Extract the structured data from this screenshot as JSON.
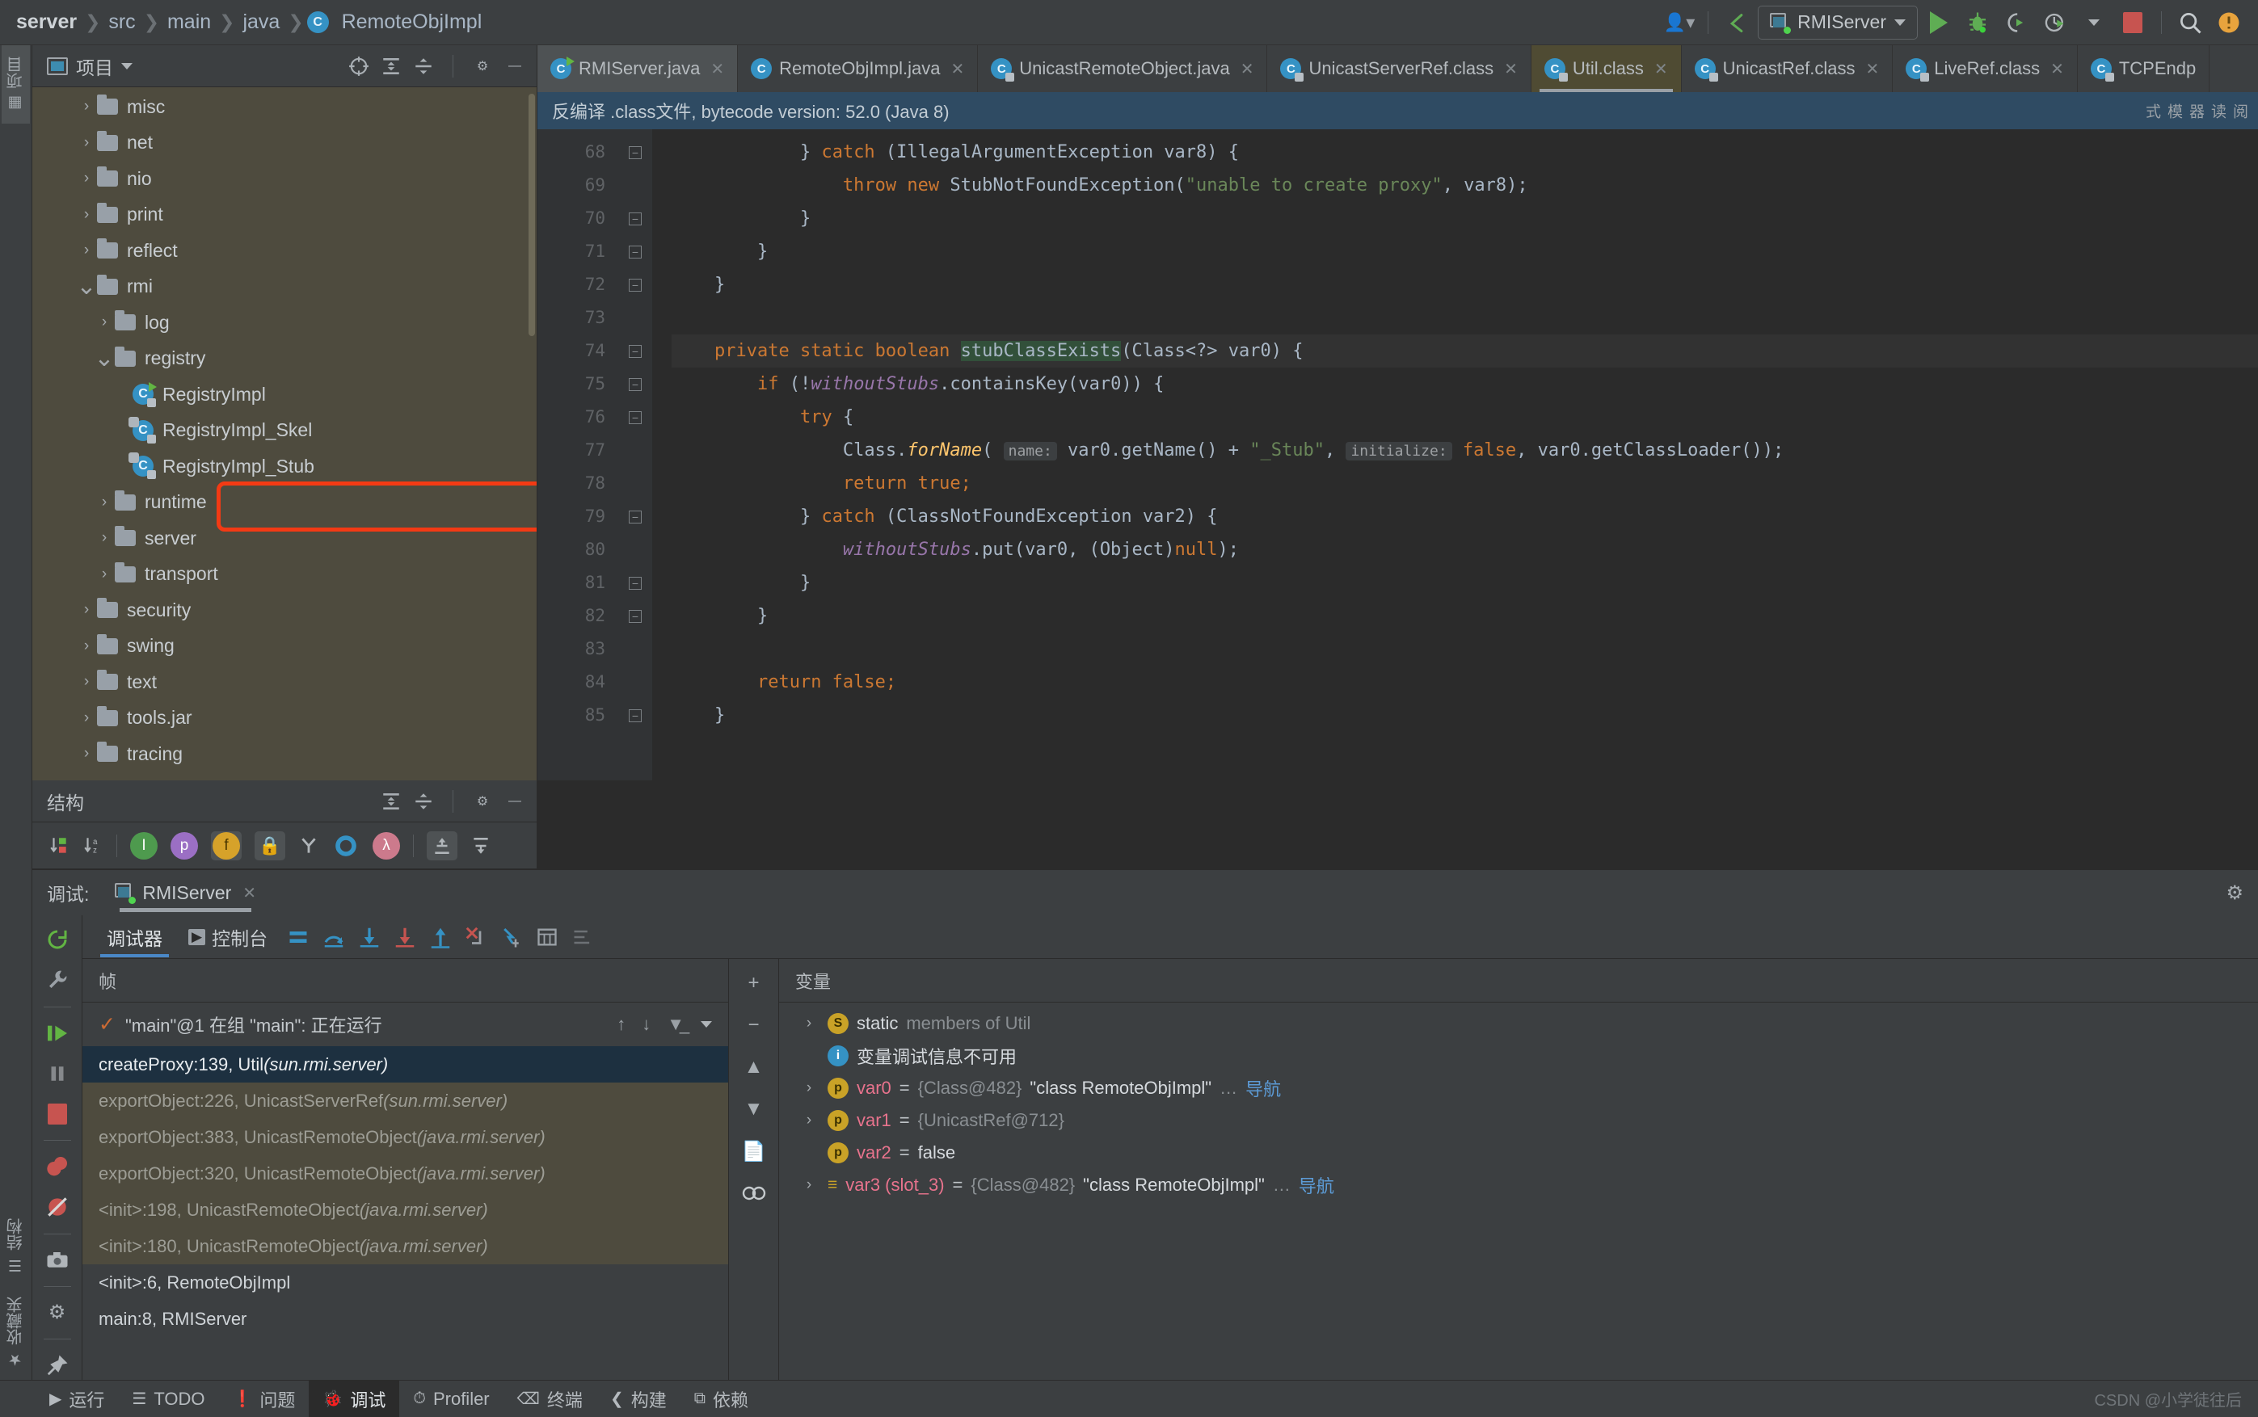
{
  "window": {
    "breadcrumb": [
      "server",
      "src",
      "main",
      "java",
      "RemoteObjImpl"
    ],
    "breadcrumb_class_letter": "C"
  },
  "toolbar": {
    "profile_icon": "user-profile-icon",
    "update_icon": "update-project-icon",
    "run_config_name": "RMIServer",
    "run_label": "run-icon",
    "debug_label": "debug-icon",
    "run_coverage_label": "run-with-coverage-icon",
    "profiler_label": "profiler-icon",
    "stop_label": "stop-icon",
    "search_label": "search-icon"
  },
  "left_strip": {
    "project_tab": "项目",
    "structure_tab": "结构",
    "favorites_tab": "收藏夹"
  },
  "project_panel": {
    "title": "项目",
    "tree": [
      {
        "label": "misc",
        "type": "folder",
        "depth": 2,
        "arrow": "collapsed"
      },
      {
        "label": "net",
        "type": "folder",
        "depth": 2,
        "arrow": "collapsed"
      },
      {
        "label": "nio",
        "type": "folder",
        "depth": 2,
        "arrow": "collapsed"
      },
      {
        "label": "print",
        "type": "folder",
        "depth": 2,
        "arrow": "collapsed"
      },
      {
        "label": "reflect",
        "type": "folder",
        "depth": 2,
        "arrow": "collapsed"
      },
      {
        "label": "rmi",
        "type": "folder",
        "depth": 2,
        "arrow": "expanded"
      },
      {
        "label": "log",
        "type": "folder",
        "depth": 3,
        "arrow": "collapsed"
      },
      {
        "label": "registry",
        "type": "folder",
        "depth": 3,
        "arrow": "expanded"
      },
      {
        "label": "RegistryImpl",
        "type": "class-run",
        "depth": 4,
        "arrow": "none"
      },
      {
        "label": "RegistryImpl_Skel",
        "type": "class-lib",
        "depth": 4,
        "arrow": "none"
      },
      {
        "label": "RegistryImpl_Stub",
        "type": "class-lib",
        "depth": 4,
        "arrow": "none"
      },
      {
        "label": "runtime",
        "type": "folder",
        "depth": 3,
        "arrow": "collapsed"
      },
      {
        "label": "server",
        "type": "folder",
        "depth": 3,
        "arrow": "collapsed"
      },
      {
        "label": "transport",
        "type": "folder",
        "depth": 3,
        "arrow": "collapsed"
      },
      {
        "label": "security",
        "type": "folder",
        "depth": 2,
        "arrow": "collapsed"
      },
      {
        "label": "swing",
        "type": "folder",
        "depth": 2,
        "arrow": "collapsed"
      },
      {
        "label": "text",
        "type": "folder",
        "depth": 2,
        "arrow": "collapsed"
      },
      {
        "label": "tools.jar",
        "type": "folder",
        "depth": 2,
        "arrow": "collapsed"
      },
      {
        "label": "tracing",
        "type": "folder",
        "depth": 2,
        "arrow": "collapsed"
      }
    ],
    "annotation": {
      "color": "#f33a14",
      "highlights": "RegistryImpl_Stub"
    }
  },
  "structure_panel": {
    "title": "结构",
    "toolbar_icons": [
      "sort-by-visibility-icon",
      "sort-alphabetically-icon",
      "show-inherited-icon",
      "show-properties-icon",
      "show-fields-icon",
      "show-non-public-icon",
      "group-by-type-icon",
      "show-anonymous-icon",
      "show-lambdas-icon",
      "expand-all-icon",
      "collapse-all-icon"
    ]
  },
  "editor": {
    "tabs": [
      {
        "label": "RMIServer.java",
        "icon": "java-class-run-icon",
        "state": "inactive"
      },
      {
        "label": "RemoteObjImpl.java",
        "icon": "java-class-icon",
        "state": "inactive"
      },
      {
        "label": "UnicastRemoteObject.java",
        "icon": "java-class-lib-icon",
        "state": "inactive"
      },
      {
        "label": "UnicastServerRef.class",
        "icon": "java-class-lib-icon",
        "state": "inactive"
      },
      {
        "label": "Util.class",
        "icon": "java-class-lib-icon",
        "state": "active"
      },
      {
        "label": "UnicastRef.class",
        "icon": "java-class-lib-icon",
        "state": "inactive"
      },
      {
        "label": "LiveRef.class",
        "icon": "java-class-lib-icon",
        "state": "inactive"
      },
      {
        "label": "TCPEndp",
        "icon": "java-class-lib-icon",
        "state": "inactive"
      }
    ],
    "notice": "反编译 .class文件, bytecode version: 52.0 (Java 8)",
    "reader_mode": "阅读器模式",
    "first_line_number": 68,
    "lines": [
      {
        "n": 68,
        "fold": "end",
        "indent": 3,
        "tokens": [
          {
            "t": "} ",
            "c": "plain"
          },
          {
            "t": "catch",
            "c": "kw"
          },
          {
            "t": " (IllegalArgumentException var8) {",
            "c": "plain"
          }
        ]
      },
      {
        "n": 69,
        "fold": "none",
        "indent": 4,
        "tokens": [
          {
            "t": "throw",
            "c": "kw"
          },
          {
            "t": " ",
            "c": "plain"
          },
          {
            "t": "new",
            "c": "kw"
          },
          {
            "t": " StubNotFoundException(",
            "c": "plain"
          },
          {
            "t": "\"unable to create proxy\"",
            "c": "str"
          },
          {
            "t": ", var8);",
            "c": "plain"
          }
        ]
      },
      {
        "n": 70,
        "fold": "end",
        "indent": 3,
        "tokens": [
          {
            "t": "}",
            "c": "plain"
          }
        ]
      },
      {
        "n": 71,
        "fold": "end",
        "indent": 2,
        "tokens": [
          {
            "t": "}",
            "c": "plain"
          }
        ]
      },
      {
        "n": 72,
        "fold": "end",
        "indent": 1,
        "tokens": [
          {
            "t": "}",
            "c": "plain"
          }
        ]
      },
      {
        "n": 73,
        "fold": "none",
        "indent": 0,
        "tokens": []
      },
      {
        "n": 74,
        "fold": "start",
        "indent": 1,
        "highlight": true,
        "tokens": [
          {
            "t": "private static boolean ",
            "c": "kw"
          },
          {
            "t": "stubClassExists",
            "c": "methhl"
          },
          {
            "t": "(Class<?> var0) {",
            "c": "plain"
          }
        ]
      },
      {
        "n": 75,
        "fold": "start",
        "indent": 2,
        "tokens": [
          {
            "t": "if",
            "c": "kw"
          },
          {
            "t": " (!",
            "c": "plain"
          },
          {
            "t": "withoutStubs",
            "c": "fld"
          },
          {
            "t": ".containsKey(var0)) {",
            "c": "plain"
          }
        ]
      },
      {
        "n": 76,
        "fold": "start",
        "indent": 3,
        "tokens": [
          {
            "t": "try",
            "c": "kw"
          },
          {
            "t": " {",
            "c": "plain"
          }
        ]
      },
      {
        "n": 77,
        "fold": "none",
        "indent": 4,
        "tokens": [
          {
            "t": "Class.",
            "c": "plain"
          },
          {
            "t": "forName",
            "c": "mth"
          },
          {
            "t": "( ",
            "c": "plain"
          },
          {
            "t": "name:",
            "c": "hint"
          },
          {
            "t": " var0.getName() + ",
            "c": "plain"
          },
          {
            "t": "\"_Stub\"",
            "c": "str"
          },
          {
            "t": ", ",
            "c": "plain"
          },
          {
            "t": "initialize:",
            "c": "hint"
          },
          {
            "t": " ",
            "c": "plain"
          },
          {
            "t": "false",
            "c": "kw"
          },
          {
            "t": ", var0.getClassLoader());",
            "c": "plain"
          }
        ]
      },
      {
        "n": 78,
        "fold": "none",
        "indent": 4,
        "tokens": [
          {
            "t": "return true;",
            "c": "kw"
          }
        ]
      },
      {
        "n": 79,
        "fold": "end",
        "indent": 3,
        "tokens": [
          {
            "t": "} ",
            "c": "plain"
          },
          {
            "t": "catch",
            "c": "kw"
          },
          {
            "t": " (ClassNotFoundException var2) {",
            "c": "plain"
          }
        ]
      },
      {
        "n": 80,
        "fold": "none",
        "indent": 4,
        "tokens": [
          {
            "t": "withoutStubs",
            "c": "fld"
          },
          {
            "t": ".put(var0, (Object)",
            "c": "plain"
          },
          {
            "t": "null",
            "c": "kw"
          },
          {
            "t": ");",
            "c": "plain"
          }
        ]
      },
      {
        "n": 81,
        "fold": "end",
        "indent": 3,
        "tokens": [
          {
            "t": "}",
            "c": "plain"
          }
        ]
      },
      {
        "n": 82,
        "fold": "end",
        "indent": 2,
        "tokens": [
          {
            "t": "}",
            "c": "plain"
          }
        ]
      },
      {
        "n": 83,
        "fold": "none",
        "indent": 0,
        "tokens": []
      },
      {
        "n": 84,
        "fold": "none",
        "indent": 2,
        "tokens": [
          {
            "t": "return false;",
            "c": "kw"
          }
        ]
      },
      {
        "n": 85,
        "fold": "end",
        "indent": 1,
        "tokens": [
          {
            "t": "}",
            "c": "plain"
          }
        ]
      }
    ]
  },
  "debug": {
    "label": "调试:",
    "session_tab": "RMIServer",
    "toolbar_tabs": [
      {
        "label": "调试器",
        "active": true
      },
      {
        "label": "控制台",
        "active": false
      }
    ],
    "left_rail_icons": [
      "rerun-icon",
      "wrench-icon",
      "resume-program-icon",
      "pause-program-icon",
      "stop-icon",
      "view-breakpoints-icon",
      "mute-breakpoints-icon",
      "screenshot-icon",
      "settings-icon",
      "pin-tab-icon"
    ],
    "step_icons": [
      "show-execution-point-icon",
      "step-over-icon",
      "step-into-icon",
      "force-step-into-icon",
      "step-out-icon",
      "drop-frame-icon",
      "run-to-cursor-icon",
      "evaluate-expression-icon",
      "settings-icon"
    ],
    "frames": {
      "header": "帧",
      "thread": "\"main\"@1 在组 \"main\": 正在运行",
      "actions": [
        "up-icon",
        "down-icon",
        "filter-icon",
        "chevron-down-icon"
      ],
      "items": [
        {
          "text": "createProxy:139, Util ",
          "pkg": "(sun.rmi.server)",
          "style": "selected"
        },
        {
          "text": "exportObject:226, UnicastServerRef ",
          "pkg": "(sun.rmi.server)",
          "style": "lib"
        },
        {
          "text": "exportObject:383, UnicastRemoteObject ",
          "pkg": "(java.rmi.server)",
          "style": "lib"
        },
        {
          "text": "exportObject:320, UnicastRemoteObject ",
          "pkg": "(java.rmi.server)",
          "style": "lib"
        },
        {
          "text": "<init>:198, UnicastRemoteObject ",
          "pkg": "(java.rmi.server)",
          "style": "lib"
        },
        {
          "text": "<init>:180, UnicastRemoteObject ",
          "pkg": "(java.rmi.server)",
          "style": "lib"
        },
        {
          "text": "<init>:6, RemoteObjImpl",
          "pkg": "",
          "style": "own"
        },
        {
          "text": "main:8, RMIServer",
          "pkg": "",
          "style": "own"
        }
      ]
    },
    "variables": {
      "header": "变量",
      "add_icon": "add-watch-icon",
      "side_icons": [
        "add-icon",
        "remove-icon",
        "up-icon",
        "down-icon",
        "copy-icon",
        "inspect-icon"
      ],
      "items": [
        {
          "expand": "collapsed",
          "badge": "S",
          "badge_kind": "static",
          "parts": [
            {
              "t": "static",
              "c": "white"
            },
            {
              "t": " members of Util",
              "c": "muted"
            }
          ]
        },
        {
          "expand": "none",
          "badge": "i",
          "badge_kind": "info",
          "parts": [
            {
              "t": "变量调试信息不可用",
              "c": "white"
            }
          ]
        },
        {
          "expand": "collapsed",
          "badge": "p",
          "badge_kind": "p",
          "parts": [
            {
              "t": "var0",
              "c": "name"
            },
            {
              "t": " = ",
              "c": "op"
            },
            {
              "t": "{Class@482}",
              "c": "ref"
            },
            {
              "t": " \"class RemoteObjImpl\"",
              "c": "str"
            },
            {
              "t": " …",
              "c": "muted"
            },
            {
              "t": " 导航",
              "c": "nav"
            }
          ]
        },
        {
          "expand": "collapsed",
          "badge": "p",
          "badge_kind": "p",
          "parts": [
            {
              "t": "var1",
              "c": "name"
            },
            {
              "t": " = ",
              "c": "op"
            },
            {
              "t": "{UnicastRef@712}",
              "c": "ref"
            }
          ]
        },
        {
          "expand": "none",
          "badge": "p",
          "badge_kind": "p",
          "parts": [
            {
              "t": "var2",
              "c": "name"
            },
            {
              "t": " = ",
              "c": "op"
            },
            {
              "t": "false",
              "c": "str"
            }
          ]
        },
        {
          "expand": "collapsed",
          "badge": "≡",
          "badge_kind": "slot",
          "parts": [
            {
              "t": "var3 (slot_3)",
              "c": "name"
            },
            {
              "t": " = ",
              "c": "op"
            },
            {
              "t": "{Class@482}",
              "c": "ref"
            },
            {
              "t": " \"class RemoteObjImpl\"",
              "c": "str"
            },
            {
              "t": " …",
              "c": "muted"
            },
            {
              "t": " 导航",
              "c": "nav"
            }
          ]
        }
      ]
    }
  },
  "statusbar": {
    "items": [
      {
        "label": "运行",
        "icon": "run-icon",
        "active": false
      },
      {
        "label": "TODO",
        "icon": "todo-icon",
        "active": false
      },
      {
        "label": "问题",
        "icon": "problems-icon",
        "active": false
      },
      {
        "label": "调试",
        "icon": "debug-icon",
        "active": true
      },
      {
        "label": "Profiler",
        "icon": "profiler-icon",
        "active": false
      },
      {
        "label": "终端",
        "icon": "terminal-icon",
        "active": false
      },
      {
        "label": "构建",
        "icon": "build-icon",
        "active": false
      },
      {
        "label": "依赖",
        "icon": "dependencies-icon",
        "active": false
      }
    ],
    "watermark": "CSDN @小学徒往后"
  },
  "colors": {
    "accent_blue": "#3592c4",
    "run_green": "#5fad54",
    "stop_red": "#c75450",
    "annotation_red": "#f33a14",
    "tree_bg": "#4e4b3e",
    "editor_bg": "#2b2b2b",
    "panel_bg": "#3c3f41"
  }
}
